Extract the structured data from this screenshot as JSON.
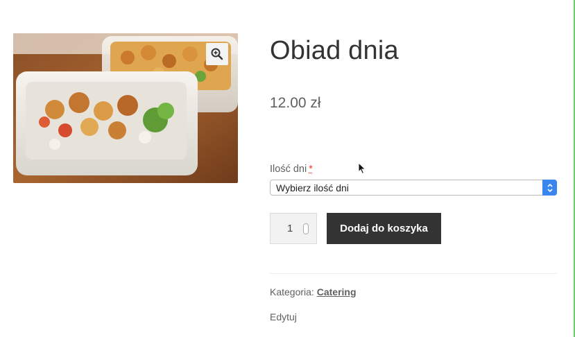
{
  "product": {
    "title": "Obiad dnia",
    "price": "12.00 zł",
    "image": "meal-prep-containers-photo"
  },
  "variation": {
    "label": "Ilość dni",
    "required_marker": "*",
    "selected": "Wybierz ilość dni"
  },
  "quantity": {
    "value": "1"
  },
  "buttons": {
    "add_to_cart": "Dodaj do koszyka",
    "zoom_icon": "zoom-in-icon"
  },
  "meta": {
    "category_label": "Kategoria:",
    "category_link": "Catering"
  },
  "edit": {
    "label": "Edytuj"
  },
  "colors": {
    "primary_button": "#333333",
    "select_accent": "#3a86f0",
    "required": "#e2401c",
    "edge_line": "#5fd35f"
  }
}
